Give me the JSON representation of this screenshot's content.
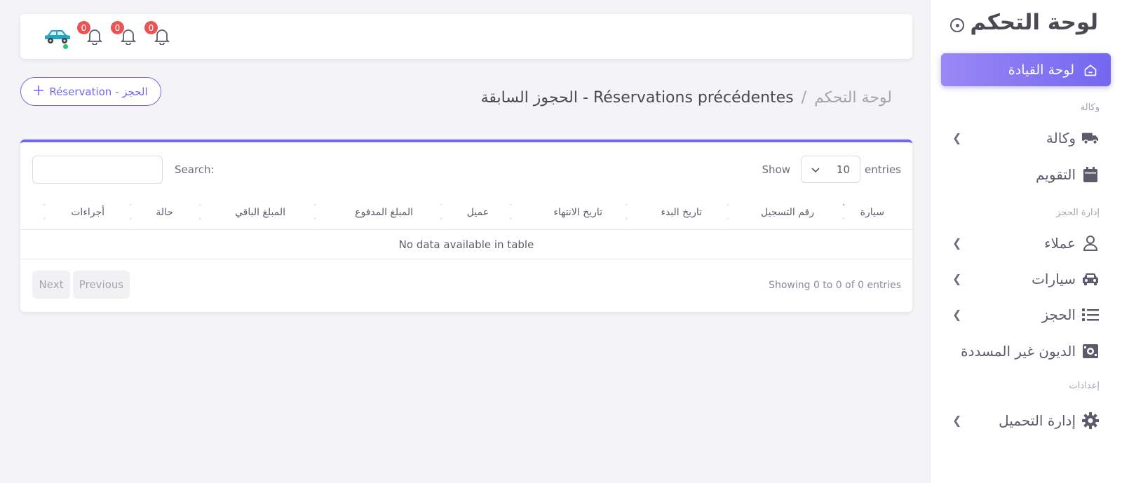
{
  "sidebar": {
    "brand": "لوحة التحكم",
    "active_item": "لوحة القيادة",
    "sections": {
      "agency": "وكالة",
      "booking_mgmt": "إدارة الحجز",
      "settings": "إعدادات"
    },
    "items": [
      {
        "label": "وكالة",
        "icon": "truck-icon"
      },
      {
        "label": "التقويم",
        "icon": "calendar-icon"
      },
      {
        "label": "عملاء",
        "icon": "user-icon"
      },
      {
        "label": "سيارات",
        "icon": "car-icon"
      },
      {
        "label": "الحجز",
        "icon": "list-icon"
      },
      {
        "label": "الديون غير المسددة",
        "icon": "money-icon"
      },
      {
        "label": "إدارة التحميل",
        "icon": "gear-icon"
      }
    ]
  },
  "topbar": {
    "badges": [
      "0",
      "0",
      "0"
    ]
  },
  "breadcrumb": {
    "home": "لوحة التحكم",
    "separator": "/",
    "current": "Réservations précédentes - الحجوز السابقة"
  },
  "reserve_button": "Réservation - الحجز",
  "table": {
    "show_label": "Show",
    "entries_label": "entries",
    "page_length": "10",
    "search_label": "Search:",
    "search_value": "",
    "columns": [
      "سيارة",
      "رقم التسجيل",
      "تاريخ البدء",
      "تاريخ الانتهاء",
      "عميل",
      "المبلغ المدفوع",
      "المبلغ الباقي",
      "حالة",
      "أجراءات"
    ],
    "empty_message": "No data available in table",
    "info": "Showing 0 to 0 of 0 entries",
    "previous": "Previous",
    "next": "Next"
  },
  "colors": {
    "accent": "#7367f0",
    "badge": "#ea5455",
    "online": "#28c76f"
  }
}
